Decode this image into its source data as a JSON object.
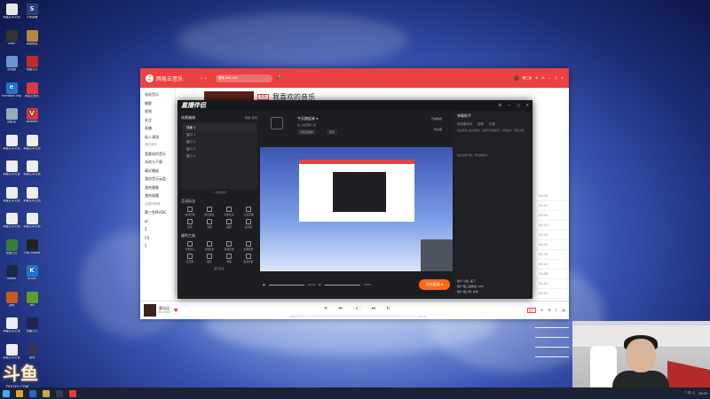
{
  "desktop": {
    "icons": [
      {
        "label": "新建文本文档",
        "glyph": "",
        "color": "#e9e9e9"
      },
      {
        "label": "斗鱼直播",
        "glyph": "S",
        "color": "#2b3f80"
      },
      {
        "label": "Geek",
        "glyph": "",
        "color": "#333"
      },
      {
        "label": "英雄联盟",
        "glyph": "",
        "color": "#b38a3a"
      },
      {
        "label": "此电脑",
        "glyph": "",
        "color": "#6a95d1"
      },
      {
        "label": "快捷方式",
        "glyph": "",
        "color": "#c02b2b"
      },
      {
        "label": "Microsoft Edge",
        "glyph": "e",
        "color": "#2176d2"
      },
      {
        "label": "网易云音乐",
        "glyph": "",
        "color": "#d83c3c"
      },
      {
        "label": "回收站",
        "glyph": "",
        "color": "#9ab"
      },
      {
        "label": "Valorant",
        "glyph": "V",
        "color": "#d23b3b"
      },
      {
        "label": "新建文本文档",
        "glyph": "",
        "color": "#eee"
      },
      {
        "label": "新建文本文档",
        "glyph": "",
        "color": "#eee"
      },
      {
        "label": "新建文本文档",
        "glyph": "",
        "color": "#eee"
      },
      {
        "label": "新建文本文档",
        "glyph": "",
        "color": "#eee"
      },
      {
        "label": "新建文本文档",
        "glyph": "",
        "color": "#eee"
      },
      {
        "label": "新建文本文档",
        "glyph": "",
        "color": "#eee"
      },
      {
        "label": "新建文本文档",
        "glyph": "",
        "color": "#eee"
      },
      {
        "label": "新建文本文档",
        "glyph": "",
        "color": "#eee"
      },
      {
        "label": "快捷方式",
        "glyph": "",
        "color": "#3a7d3a"
      },
      {
        "label": "OBS Studio",
        "glyph": "",
        "color": "#222"
      },
      {
        "label": "Steam",
        "glyph": "",
        "color": "#1a2a44"
      },
      {
        "label": "KOOK",
        "glyph": "K",
        "color": "#1f78d1"
      },
      {
        "label": "游戏",
        "glyph": "",
        "color": "#c65a23"
      },
      {
        "label": "360",
        "glyph": "",
        "color": "#5aa02c"
      },
      {
        "label": "新建文本文档",
        "glyph": "",
        "color": "#eee"
      },
      {
        "label": "快捷方式",
        "glyph": "",
        "color": "#225"
      },
      {
        "label": "新建文本文档",
        "glyph": "",
        "color": "#eee"
      },
      {
        "label": "游戏",
        "glyph": "",
        "color": "#335"
      }
    ]
  },
  "netease": {
    "app_title": "网易云音乐",
    "nav_arrows": "‹ ›",
    "search_placeholder": "搜索 Hot 100",
    "mic_icon": "🎤",
    "username": "曦三鱼",
    "win_buttons": [
      "⚙",
      "✉",
      "—",
      "□",
      "✕"
    ],
    "sidebar": [
      {
        "label": "发现音乐",
        "sub": false
      },
      {
        "label": "播客",
        "sub": false
      },
      {
        "label": "视频",
        "sub": false
      },
      {
        "label": "关注",
        "sub": false
      },
      {
        "label": "直播",
        "sub": false
      },
      {
        "label": "私人漫游",
        "sub": false
      },
      {
        "label": "我的音乐",
        "sub": true
      },
      {
        "label": "我喜欢的音乐",
        "sub": false
      },
      {
        "label": "本地与下载",
        "sub": false
      },
      {
        "label": "最近播放",
        "sub": false
      },
      {
        "label": "我的音乐云盘",
        "sub": false
      },
      {
        "label": "我的播客",
        "sub": false
      },
      {
        "label": "我的收藏",
        "sub": false
      },
      {
        "label": "创建的歌单",
        "sub": true
      },
      {
        "label": "曦三鱼MUSIC",
        "sub": false
      },
      {
        "label": "al",
        "sub": false
      },
      {
        "label": "5",
        "sub": false
      },
      {
        "label": "CS",
        "sub": false
      },
      {
        "label": "5",
        "sub": false
      }
    ],
    "playlist": {
      "tag": "歌单",
      "title": "我喜欢的音乐"
    },
    "list_times": [
      "04:28",
      "04:21",
      "03:55",
      "04:12",
      "03:40",
      "04:02",
      "03:33",
      "04:10",
      "03:58",
      "04:15",
      "03:47",
      "04:05",
      "04:30",
      "03:36",
      "03:44",
      "04:22",
      "03:59"
    ],
    "now_playing": {
      "song": "墨勾运",
      "artist": "Bondjet",
      "time_left": "00:53",
      "time_right": "04:58"
    },
    "controls": [
      "✕",
      "⏮",
      "⏸",
      "⏭",
      "↻"
    ],
    "right_icons": {
      "quality": "极高",
      "icons": [
        "⟲",
        "☰",
        "♪",
        "▤"
      ]
    }
  },
  "streamtool": {
    "logo": "直播伴侣",
    "win_buttons": [
      "⚙",
      "—",
      "□",
      "✕"
    ],
    "scene_title": "场景编辑",
    "scene_tabs": [
      "场景",
      "游戏"
    ],
    "scene_rows": [
      "场景 1",
      "窗口 1",
      "窗口 2",
      "窗口 3",
      "窗口 4"
    ],
    "add_source": "+ 添加素材",
    "tools_title": "互动玩法",
    "tools": [
      "连线直播",
      "语音连麦",
      "礼物互动",
      "盲盒直播",
      "投票",
      "答题",
      "福袋",
      "画中画"
    ],
    "more_title": "福利工具",
    "more": [
      "分发中心",
      "直播切片",
      "直播复盘",
      "主播招募",
      "红包雨",
      "抽奖",
      "弹幕",
      "更多功能"
    ],
    "expand": "展开更多",
    "header": {
      "title": "今天跑起来 ▾",
      "sub": "在上线自我介绍",
      "btn1": "开启直播前",
      "btn2": "音乐",
      "stat1": "开播数据",
      "stat2": "粉丝团"
    },
    "volume1": "100%",
    "volume2": "100%",
    "golive": "开始直播 ▾",
    "right_title": "弹幕助手",
    "right_tabs": [
      "在线观众PK",
      "勋章",
      "礼物"
    ],
    "right_msg1": "欢迎来到斗鱼直播间，请遵守直播规范，文明发言，理性消费。",
    "right_msg2": "欢迎主播开播，祝直播顺利！",
    "chat": [
      "用户 小鱼: 来了",
      "用户 曦三鱼粉丝: 666",
      "用户 路人甲: 好听"
    ]
  },
  "overlay": {
    "brand": "斗鱼",
    "url": "DOUYU.COM"
  },
  "taskbar": {
    "time": "19:45",
    "tray": "^ 中 ♫"
  }
}
